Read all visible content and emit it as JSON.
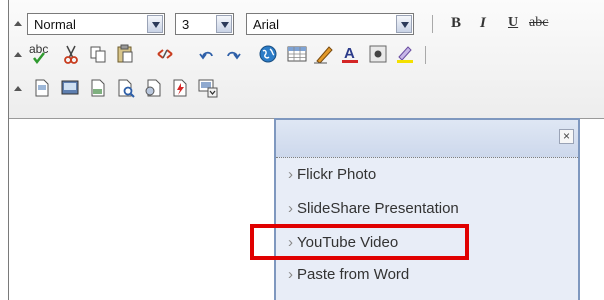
{
  "toolbar": {
    "paragraph_format": "Normal",
    "font_size": "3",
    "font_name": "Arial",
    "bold": "B",
    "italic": "I",
    "underline": "U",
    "strike": "abc",
    "spellcheck": "abc"
  },
  "popup": {
    "close": "×",
    "items": [
      {
        "label": "Flickr Photo"
      },
      {
        "label": "SlideShare Presentation"
      },
      {
        "label": "YouTube Video"
      },
      {
        "label": "Paste from Word"
      }
    ]
  },
  "colors": {
    "highlight": "#e00000",
    "popup_bg": "#e8edf7",
    "popup_border": "#7f98bf"
  },
  "icons": [
    "scroll-up-icon",
    "spellcheck-icon",
    "cut-icon",
    "copy-icon",
    "paste-icon",
    "unlink-icon",
    "undo-icon",
    "redo-icon",
    "globe-icon",
    "table-icon",
    "pencil-icon",
    "font-color-icon",
    "special-char-icon",
    "highlight-icon",
    "new-page-icon",
    "image-icon",
    "document-icon",
    "preview-icon",
    "find-icon",
    "flash-icon",
    "more-plugins-icon"
  ]
}
